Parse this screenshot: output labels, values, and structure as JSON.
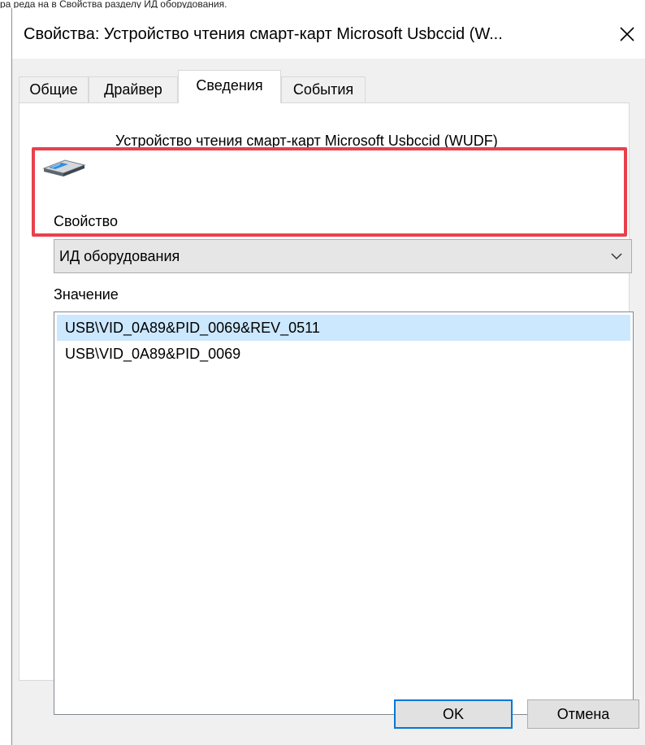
{
  "caption_strip": {
    "text": "ра реда на в     Свойства    разделу ИД оборудования."
  },
  "window": {
    "title": "Свойства: Устройство чтения смарт-карт Microsoft Usbccid (W...",
    "close_glyph": "✕"
  },
  "tabs": [
    {
      "label": "Общие",
      "active": false
    },
    {
      "label": "Драйвер",
      "active": false
    },
    {
      "label": "Сведения",
      "active": true
    },
    {
      "label": "События",
      "active": false
    }
  ],
  "device": {
    "icon": "smart-card-reader-icon",
    "name": "Устройство чтения смарт-карт Microsoft Usbccid (WUDF)"
  },
  "property": {
    "label": "Свойство",
    "selected": "ИД оборудования"
  },
  "value": {
    "label": "Значение",
    "items": [
      {
        "text": "USB\\VID_0A89&PID_0069&REV_0511",
        "selected": true
      },
      {
        "text": "USB\\VID_0A89&PID_0069",
        "selected": false
      }
    ]
  },
  "buttons": {
    "ok": "OK",
    "cancel": "Отмена"
  },
  "colors": {
    "highlight": "#e8414c",
    "selection": "#cce8ff",
    "default_button_border": "#0078d7"
  }
}
